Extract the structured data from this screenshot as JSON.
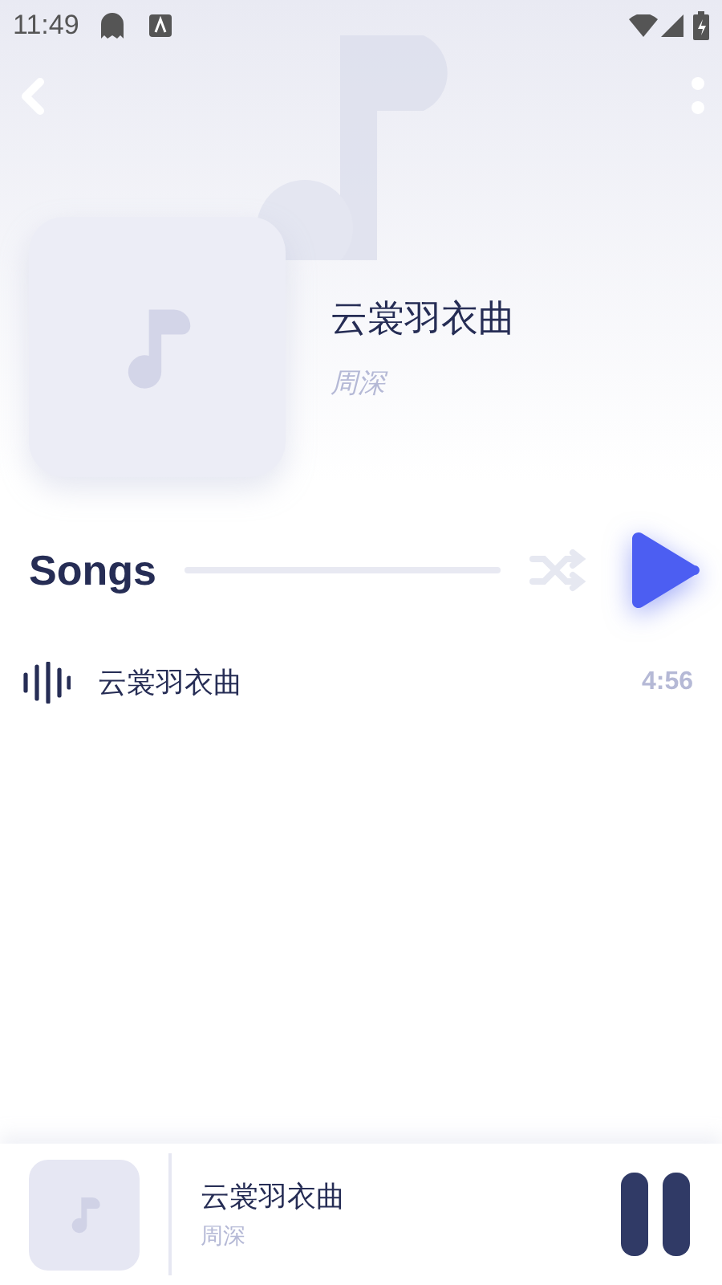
{
  "status_bar": {
    "time": "11:49"
  },
  "album": {
    "title": "云裳羽衣曲",
    "artist": "周深"
  },
  "section": {
    "title": "Songs"
  },
  "tracks": [
    {
      "title": "云裳羽衣曲",
      "duration": "4:56",
      "playing": true
    }
  ],
  "mini_player": {
    "title": "云裳羽衣曲",
    "artist": "周深",
    "playing": true
  }
}
